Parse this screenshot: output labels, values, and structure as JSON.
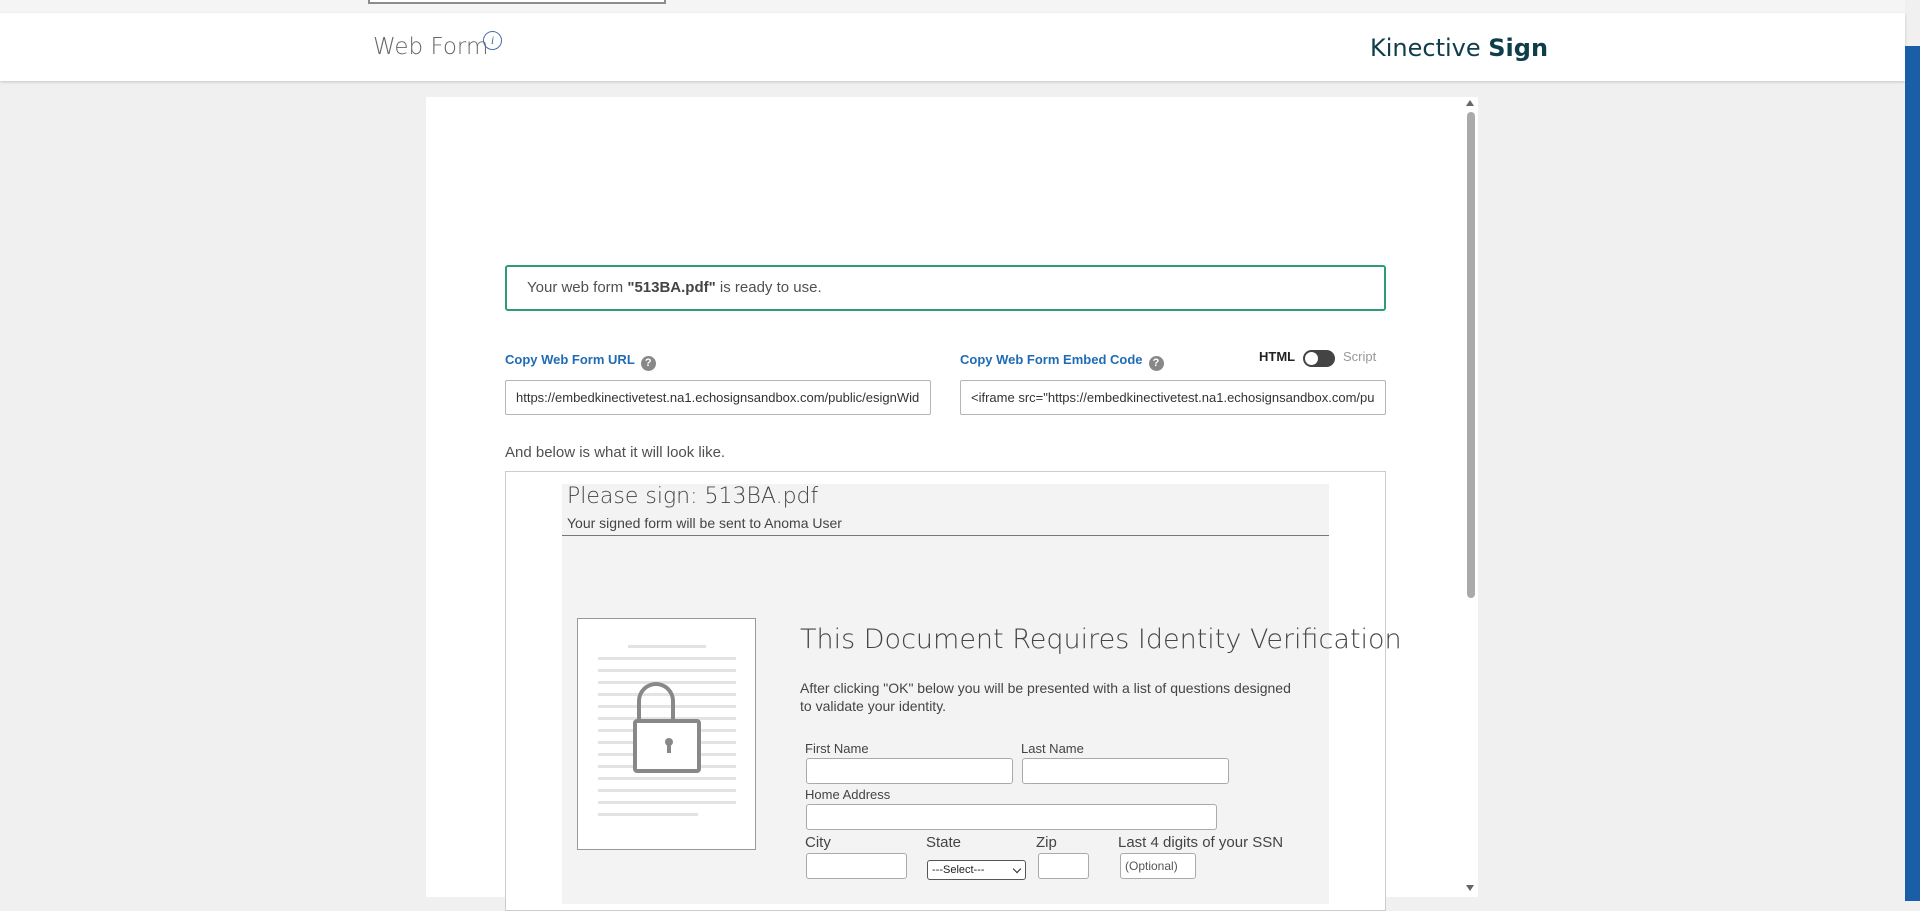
{
  "header": {
    "title": "Web Form",
    "brand_regular": "Kinective",
    "brand_bold": "Sign"
  },
  "success": {
    "prefix": "Your web form ",
    "filename": "\"513BA.pdf\"",
    "suffix": " is ready to use."
  },
  "url_field": {
    "label": "Copy Web Form URL",
    "value": "https://embedkinectivetest.na1.echosignsandbox.com/public/esignWid"
  },
  "embed_field": {
    "label": "Copy Web Form Embed Code",
    "value": "<iframe src=\"https://embedkinectivetest.na1.echosignsandbox.com/pu"
  },
  "toggle": {
    "left_label": "HTML",
    "right_label": "Script"
  },
  "preview_intro": "And below is what it will look like.",
  "preview": {
    "title": "Please sign: 513BA.pdf",
    "subtitle": "Your signed form will be sent to Anoma User",
    "heading": "This Document Requires Identity Verification",
    "description": "After clicking \"OK\" below you will be presented with a list of questions designed to validate your identity.",
    "fields": {
      "first_name": "First Name",
      "last_name": "Last Name",
      "home_address": "Home Address",
      "city": "City",
      "state": "State",
      "state_selected": "---Select---",
      "zip": "Zip",
      "ssn": "Last 4 digits of your SSN",
      "ssn_placeholder": "(Optional)"
    }
  },
  "colors": {
    "brand": "#0f3d4c",
    "accent_link": "#1f6cb4",
    "success_border": "#2d9c72",
    "side_bar": "#1a5ea8"
  }
}
